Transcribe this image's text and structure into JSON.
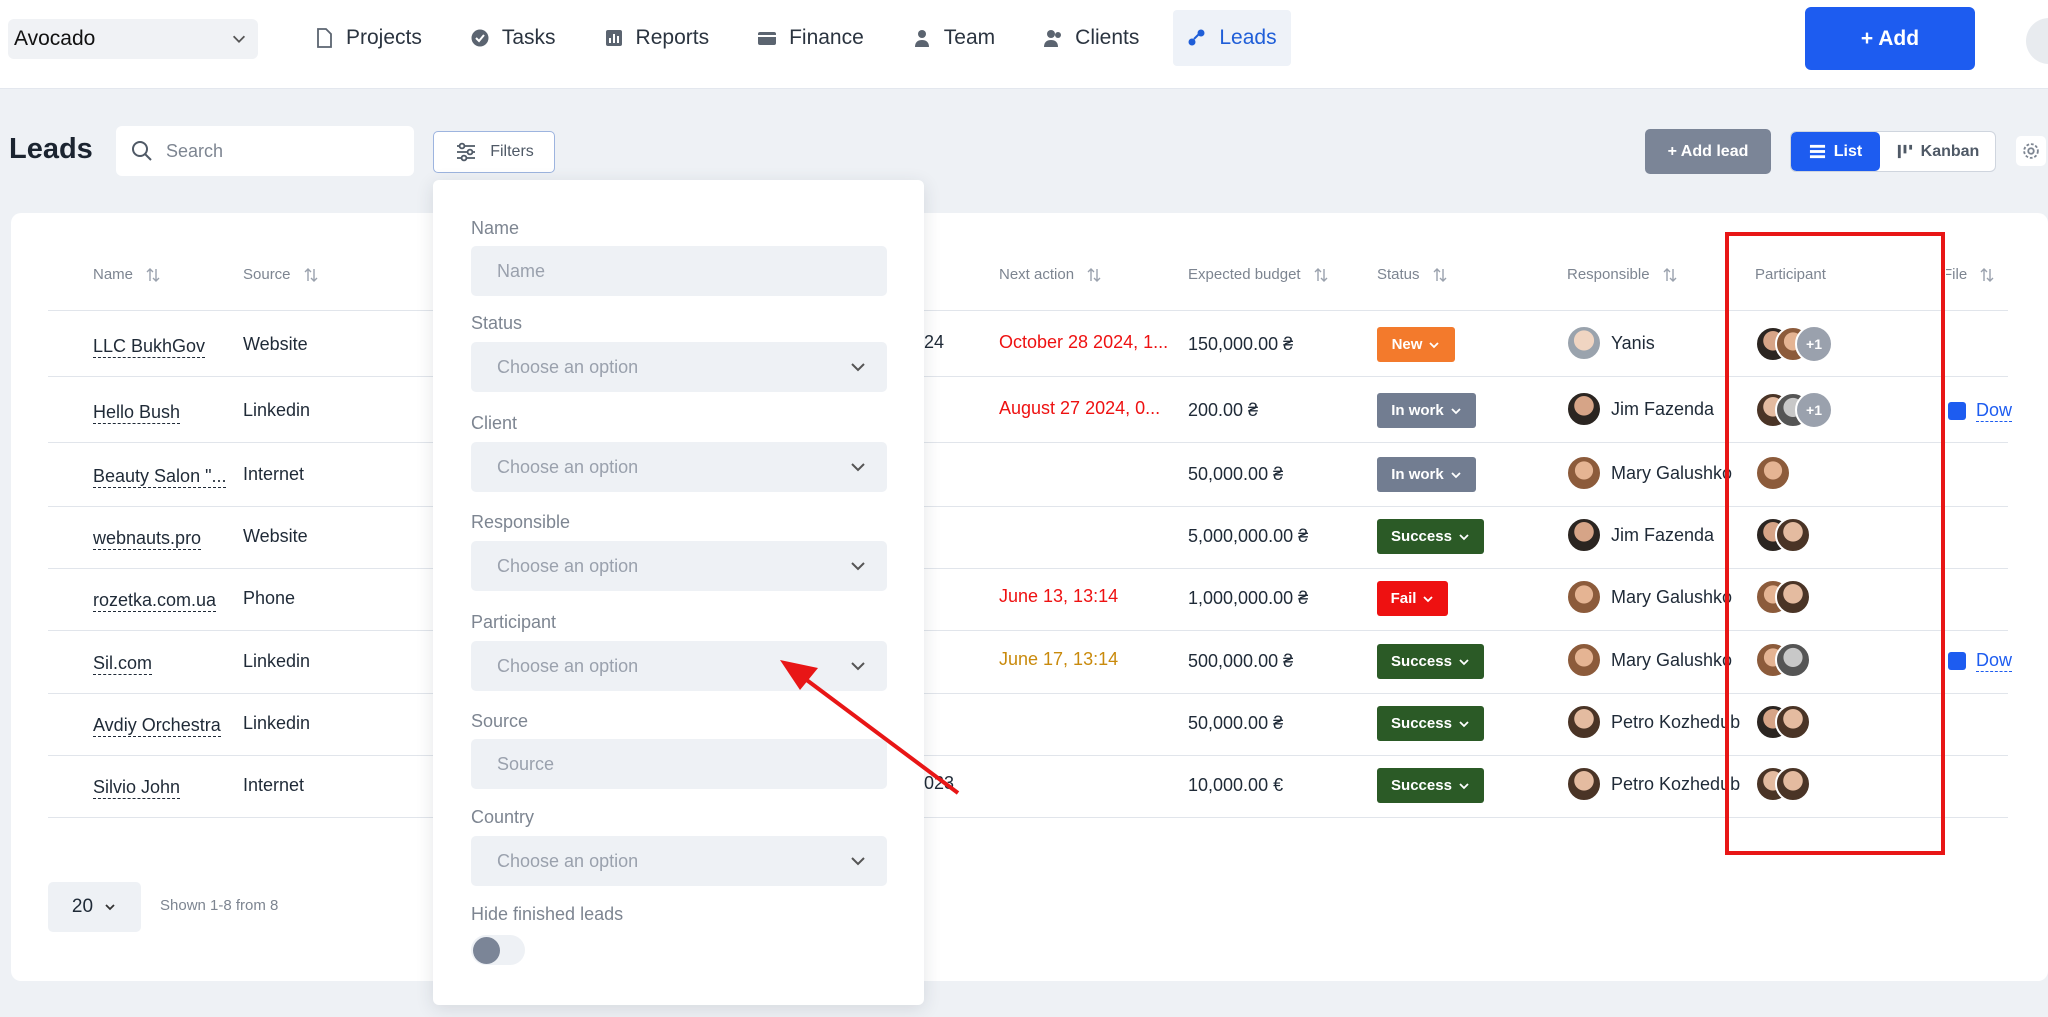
{
  "workspace": {
    "name": "Avocado"
  },
  "nav": [
    {
      "label": "Projects",
      "icon": "file-icon"
    },
    {
      "label": "Tasks",
      "icon": "check-circle-icon"
    },
    {
      "label": "Reports",
      "icon": "chart-icon"
    },
    {
      "label": "Finance",
      "icon": "wallet-icon"
    },
    {
      "label": "Team",
      "icon": "person-icon"
    },
    {
      "label": "Clients",
      "icon": "people-icon"
    },
    {
      "label": "Leads",
      "icon": "leads-icon",
      "active": true
    }
  ],
  "add_button": "+ Add",
  "page": {
    "title": "Leads",
    "search_placeholder": "Search",
    "filters_label": "Filters",
    "add_lead_label": "+ Add lead",
    "view_list": "List",
    "view_kanban": "Kanban"
  },
  "table": {
    "columns": [
      "Name",
      "Source",
      "Next action",
      "Expected budget",
      "Status",
      "Responsible",
      "Participant",
      "File"
    ],
    "rows": [
      {
        "name": "LLC BukhGov",
        "source": "Website",
        "hidden_fragment": "24",
        "next_action": "October 28 2024, 1...",
        "next_action_color": "#ee1111",
        "budget": "150,000.00 ₴",
        "status": "New",
        "responsible": "Yanis",
        "participants_extra": "+1",
        "file": ""
      },
      {
        "name": "Hello Bush",
        "source": "Linkedin",
        "hidden_fragment": "",
        "next_action": "August 27 2024, 0...",
        "next_action_color": "#ee1111",
        "budget": "200.00 ₴",
        "status": "In work",
        "responsible": "Jim Fazenda",
        "participants_extra": "+1",
        "file": "Dow"
      },
      {
        "name": "Beauty Salon \"...",
        "source": "Internet",
        "hidden_fragment": "",
        "next_action": "",
        "next_action_color": "",
        "budget": "50,000.00 ₴",
        "status": "In work",
        "responsible": "Mary Galushko",
        "participants_extra": "",
        "file": ""
      },
      {
        "name": "webnauts.pro",
        "source": "Website",
        "hidden_fragment": "",
        "next_action": "",
        "next_action_color": "",
        "budget": "5,000,000.00 ₴",
        "status": "Success",
        "responsible": "Jim Fazenda",
        "participants_extra": "",
        "file": ""
      },
      {
        "name": "rozetka.com.ua",
        "source": "Phone",
        "hidden_fragment": "",
        "next_action": "June 13, 13:14",
        "next_action_color": "#ee1111",
        "budget": "1,000,000.00 ₴",
        "status": "Fail",
        "responsible": "Mary Galushko",
        "participants_extra": "",
        "file": ""
      },
      {
        "name": "Sil.com",
        "source": "Linkedin",
        "hidden_fragment": "",
        "next_action": "June 17, 13:14",
        "next_action_color": "#c98a0c",
        "budget": "500,000.00 ₴",
        "status": "Success",
        "responsible": "Mary Galushko",
        "participants_extra": "",
        "file": "Dow"
      },
      {
        "name": "Avdiy Orchestra",
        "source": "Linkedin",
        "hidden_fragment": "",
        "next_action": "",
        "next_action_color": "",
        "budget": "50,000.00 ₴",
        "status": "Success",
        "responsible": "Petro Kozhedub",
        "participants_extra": "",
        "file": ""
      },
      {
        "name": "Silvio John",
        "source": "Internet",
        "hidden_fragment": "023",
        "next_action": "",
        "next_action_color": "",
        "budget": "10,000.00 €",
        "status": "Success",
        "responsible": "Petro Kozhedub",
        "participants_extra": "",
        "file": ""
      }
    ]
  },
  "pagination": {
    "per_page": "20",
    "shown": "Shown 1-8 from 8"
  },
  "filter_panel": {
    "fields": [
      {
        "label": "Name",
        "placeholder": "Name",
        "type": "text"
      },
      {
        "label": "Status",
        "placeholder": "Choose an option",
        "type": "select"
      },
      {
        "label": "Client",
        "placeholder": "Choose an option",
        "type": "select"
      },
      {
        "label": "Responsible",
        "placeholder": "Choose an option",
        "type": "select"
      },
      {
        "label": "Participant",
        "placeholder": "Choose an option",
        "type": "select"
      },
      {
        "label": "Source",
        "placeholder": "Source",
        "type": "text"
      },
      {
        "label": "Country",
        "placeholder": "Choose an option",
        "type": "select"
      }
    ],
    "hide_finished_label": "Hide finished leads",
    "hide_finished_on": false
  },
  "colors": {
    "accent": "#1d5cf0",
    "status_new": "#f37a2c",
    "status_in_work": "#727d91",
    "status_success": "#2b5a26",
    "status_fail": "#ee1111",
    "annotation": "#e81616"
  }
}
